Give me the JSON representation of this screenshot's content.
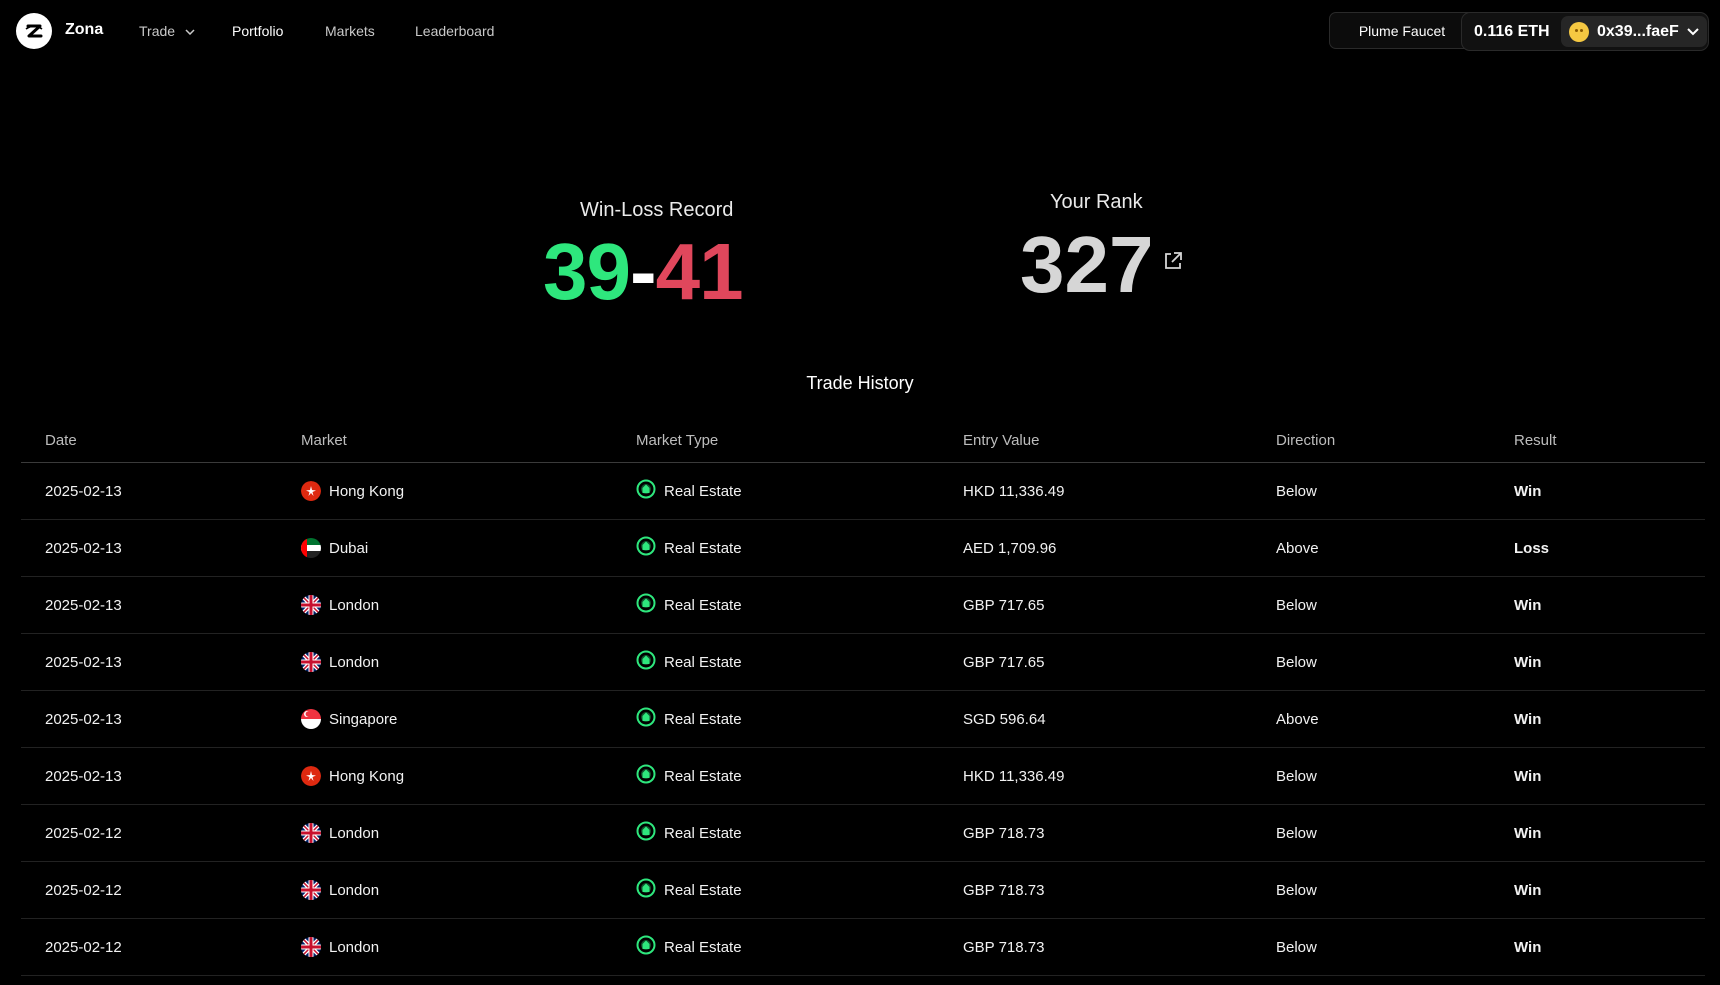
{
  "header": {
    "brand": "Zona",
    "nav": {
      "trade": "Trade",
      "portfolio": "Portfolio",
      "markets": "Markets",
      "leaderboard": "Leaderboard"
    },
    "faucet_button": "Plume Faucet",
    "balance": "0.116 ETH",
    "account": "0x39...faeF"
  },
  "stats": {
    "record_label": "Win-Loss Record",
    "wins": "39",
    "separator": "-",
    "losses": "41",
    "rank_label": "Your Rank",
    "rank": "327"
  },
  "trade_history": {
    "title": "Trade History",
    "columns": [
      "Date",
      "Market",
      "Market Type",
      "Entry Value",
      "Direction",
      "Result"
    ],
    "rows": [
      {
        "date": "2025-02-13",
        "market": "Hong Kong",
        "flag": "hk",
        "market_type": "Real Estate",
        "entry_value": "HKD 11,336.49",
        "direction": "Below",
        "result": "Win"
      },
      {
        "date": "2025-02-13",
        "market": "Dubai",
        "flag": "ae",
        "market_type": "Real Estate",
        "entry_value": "AED 1,709.96",
        "direction": "Above",
        "result": "Loss"
      },
      {
        "date": "2025-02-13",
        "market": "London",
        "flag": "uk",
        "market_type": "Real Estate",
        "entry_value": "GBP 717.65",
        "direction": "Below",
        "result": "Win"
      },
      {
        "date": "2025-02-13",
        "market": "London",
        "flag": "uk",
        "market_type": "Real Estate",
        "entry_value": "GBP 717.65",
        "direction": "Below",
        "result": "Win"
      },
      {
        "date": "2025-02-13",
        "market": "Singapore",
        "flag": "sg",
        "market_type": "Real Estate",
        "entry_value": "SGD 596.64",
        "direction": "Above",
        "result": "Win"
      },
      {
        "date": "2025-02-13",
        "market": "Hong Kong",
        "flag": "hk",
        "market_type": "Real Estate",
        "entry_value": "HKD 11,336.49",
        "direction": "Below",
        "result": "Win"
      },
      {
        "date": "2025-02-12",
        "market": "London",
        "flag": "uk",
        "market_type": "Real Estate",
        "entry_value": "GBP 718.73",
        "direction": "Below",
        "result": "Win"
      },
      {
        "date": "2025-02-12",
        "market": "London",
        "flag": "uk",
        "market_type": "Real Estate",
        "entry_value": "GBP 718.73",
        "direction": "Below",
        "result": "Win"
      },
      {
        "date": "2025-02-12",
        "market": "London",
        "flag": "uk",
        "market_type": "Real Estate",
        "entry_value": "GBP 718.73",
        "direction": "Below",
        "result": "Win"
      }
    ]
  },
  "colors": {
    "win": "#2ee77d",
    "loss": "#e0475c",
    "background": "#000000"
  },
  "icons": {
    "logo": "zona-logo-icon",
    "external_link": "external-link-icon",
    "market_type": "real-estate-icon"
  }
}
